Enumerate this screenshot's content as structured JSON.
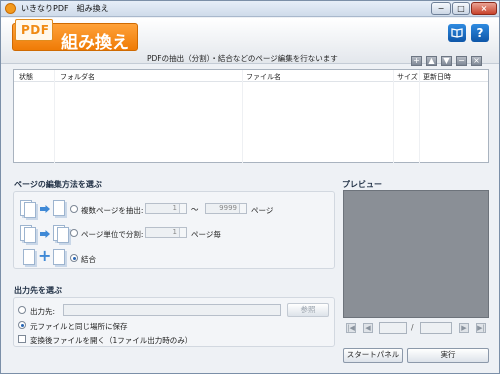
{
  "window": {
    "title": "いきなりPDF　組み換え",
    "controls": {
      "minimize": "−",
      "maximize": "□",
      "close": "×"
    }
  },
  "header": {
    "pdf_label": "PDF",
    "title": "組み換え",
    "subtitle": "PDFの抽出（分割）・結合などのページ編集を行ないます",
    "icons": {
      "book": "book-icon",
      "help": "?"
    },
    "list_buttons": [
      "+",
      "▲",
      "▼",
      "−",
      "×"
    ]
  },
  "file_list": {
    "columns": [
      "状態",
      "フォルダ名",
      "ファイル名",
      "サイズ",
      "更新日時"
    ]
  },
  "edit_method": {
    "section_label": "ページの編集方法を選ぶ",
    "options": [
      {
        "label": "複数ページを抽出:",
        "selected": false,
        "from": "1",
        "to": "9999",
        "unit_tilde": "〜",
        "unit": "ページ"
      },
      {
        "label": "ページ単位で分割:",
        "selected": false,
        "value": "1",
        "unit": "ページ毎"
      },
      {
        "label": "結合",
        "selected": true
      }
    ]
  },
  "output": {
    "section_label": "出力先を選ぶ",
    "dest_label": "出力先:",
    "dest_value": "",
    "browse_label": "参照",
    "same_folder_label": "元ファイルと同じ場所に保存",
    "open_after_label": "変換後ファイルを開く（1ファイル出力時のみ）"
  },
  "preview": {
    "label": "プレビュー",
    "nav": {
      "first": "|◀",
      "prev": "◀",
      "next": "▶",
      "last": "▶|",
      "separator": "/"
    },
    "current_page": "",
    "total_pages": ""
  },
  "footer": {
    "start_panel_label": "スタートパネル",
    "run_label": "実行"
  },
  "colors": {
    "accent": "#f08a14",
    "titlebar": "#cfdbea",
    "preview_bg": "#8a8f96"
  }
}
